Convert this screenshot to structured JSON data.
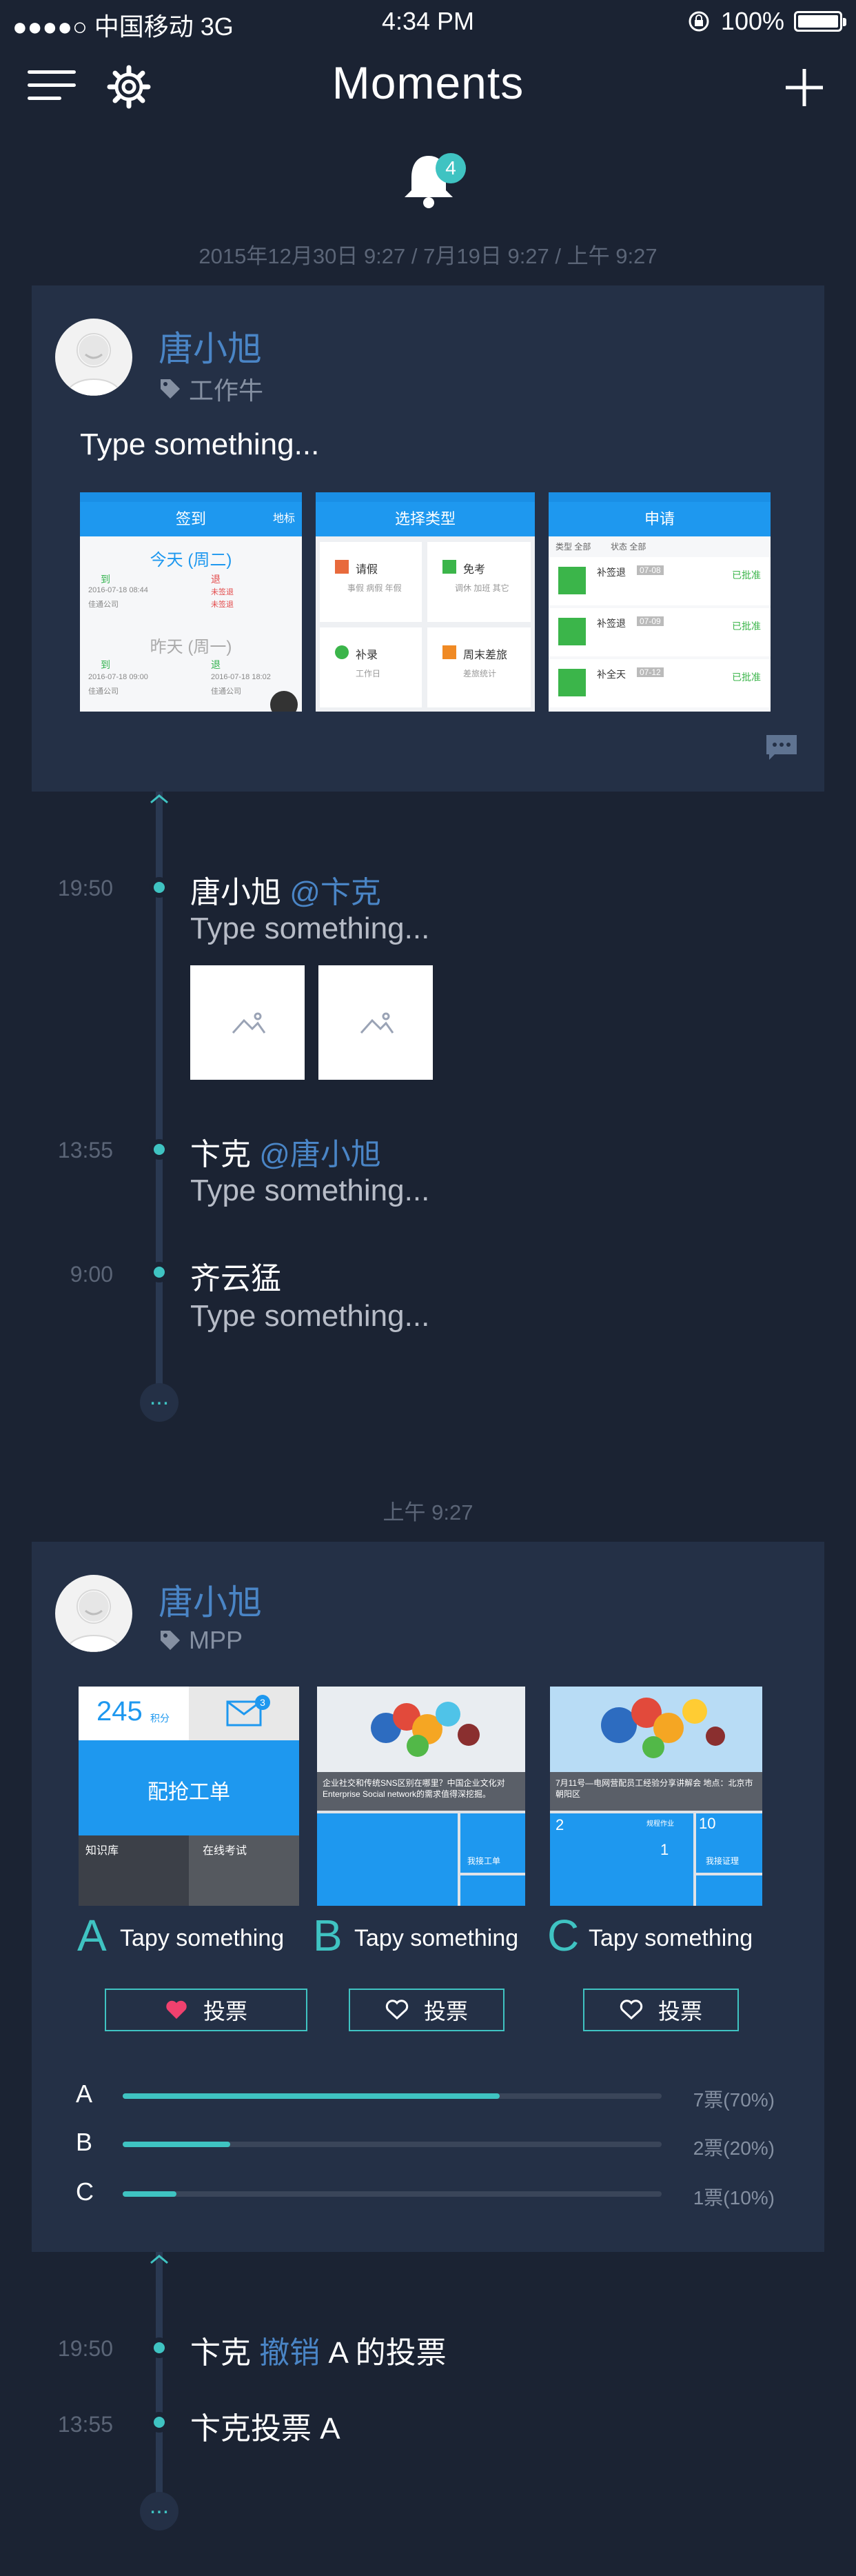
{
  "status_bar": {
    "carrier": "●●●●○ 中国移动  3G",
    "time": "4:34 PM",
    "battery": "100%"
  },
  "nav": {
    "title": "Moments"
  },
  "notification": {
    "count": "4"
  },
  "dates_line": "2015年12月30日  9:27 / 7月19日  9:27 / 上午  9:27",
  "post1": {
    "author": "唐小旭",
    "tag": "工作牛",
    "text": "Type something...",
    "shots": [
      {
        "title": "签到",
        "right": "地标",
        "lines": [
          "今天 (周二)",
          "到",
          "退",
          "2016-07-18 08:44",
          "未签退",
          "佳通公司",
          "未签退",
          "昨天 (周一)",
          "到",
          "退",
          "2016-07-18 09:00",
          "2016-07-18 18:02",
          "佳通公司",
          "佳通公司"
        ]
      },
      {
        "title": "选择类型",
        "items": [
          {
            "name": "请假",
            "desc": "事假 病假 年假"
          },
          {
            "name": "免考",
            "desc": "调休 加班 其它"
          },
          {
            "name": "补录",
            "desc": "工作日"
          },
          {
            "name": "周末差旅",
            "desc": "差旅统计"
          }
        ]
      },
      {
        "title": "申请",
        "filters": [
          "类型 全部",
          "状态 全部"
        ],
        "rows": [
          {
            "name": "补签退",
            "date": "07-08",
            "status": "已批准"
          },
          {
            "name": "补签退",
            "date": "07-09",
            "status": "已批准"
          },
          {
            "name": "补全天",
            "date": "07-12",
            "status": "已批准"
          }
        ]
      }
    ]
  },
  "timeline1": [
    {
      "time": "19:50",
      "name": "唐小旭",
      "mention": "@卞克",
      "text": "Type something..."
    },
    {
      "time": "13:55",
      "name": "卞克",
      "mention": "@唐小旭",
      "text": "Type something..."
    },
    {
      "time": "9:00",
      "name": "齐云猛",
      "mention": "",
      "text": "Type something..."
    }
  ],
  "more_label": "...",
  "section_time": "上午  9:27",
  "post2": {
    "author": "唐小旭",
    "tag": "MPP",
    "thumb_a": {
      "score": "245",
      "score_unit": "积分",
      "badge": "3",
      "title": "配抢工单",
      "knowledge": "知识库",
      "exam": "在线考试"
    },
    "thumb_b": {
      "caption": "企业社交和传统SNS区别在哪里？中国企业文化对 Enterprise Social network的需求值得深挖掘。",
      "tile": "我接工单"
    },
    "thumb_c": {
      "caption": "7月11号—电网营配员工经验分享讲解会 地点：北京市朝阳区",
      "num1": "2",
      "num2": "1",
      "num3": "10",
      "tile1": "规程作业",
      "tile2": "我接证理"
    },
    "options": [
      {
        "letter": "A",
        "text": "Tapy something",
        "vote": "投票",
        "voted": true
      },
      {
        "letter": "B",
        "text": "Tapy something",
        "vote": "投票",
        "voted": false
      },
      {
        "letter": "C",
        "text": "Tapy something",
        "vote": "投票",
        "voted": false
      }
    ],
    "results": [
      {
        "letter": "A",
        "fraction": 0.7,
        "count": "7票(70%)"
      },
      {
        "letter": "B",
        "fraction": 0.2,
        "count": "2票(20%)"
      },
      {
        "letter": "C",
        "fraction": 0.1,
        "count": "1票(10%)"
      }
    ]
  },
  "timeline2": [
    {
      "time": "19:50",
      "name": "卞克",
      "action": "撤销",
      "rest": "A 的投票"
    },
    {
      "time": "13:55",
      "name": "卞克投票 A",
      "action": "",
      "rest": ""
    }
  ],
  "colors": {
    "background": "#1b2333",
    "card": "#243046",
    "accent": "#3fc3c2",
    "link": "#4a85c6",
    "muted": "#5b6577"
  }
}
